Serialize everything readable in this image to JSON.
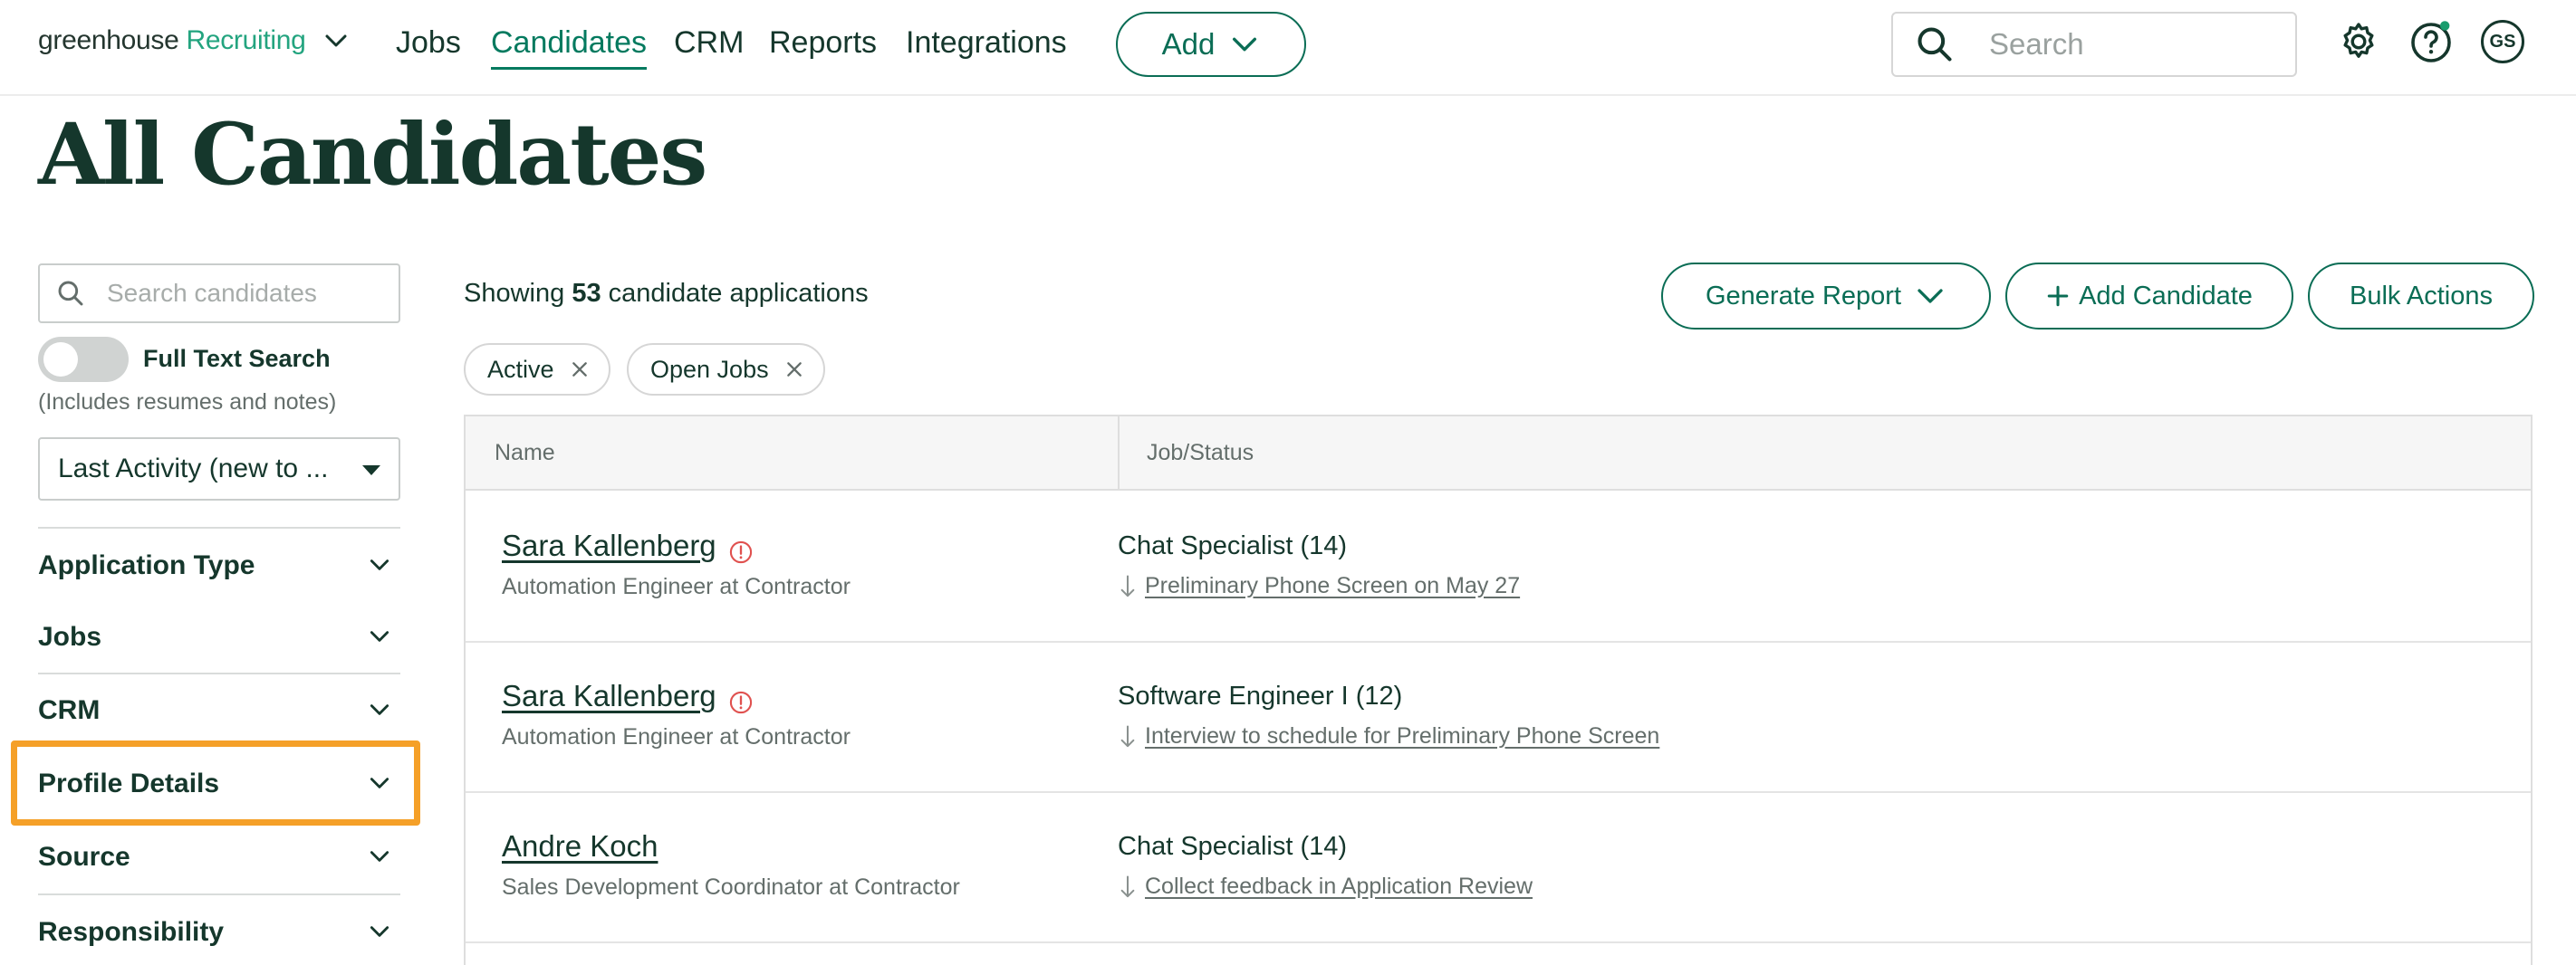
{
  "nav": {
    "logo_word1": "greenhouse",
    "logo_word2": "Recruiting",
    "links": [
      "Jobs",
      "Candidates",
      "CRM",
      "Reports",
      "Integrations"
    ],
    "active_link": "Candidates",
    "add_label": "Add",
    "search_placeholder": "Search",
    "avatar_initials": "GS"
  },
  "page": {
    "title": "All Candidates"
  },
  "sidebar": {
    "search_placeholder": "Search candidates",
    "full_text_label": "Full Text Search",
    "full_text_note": "(Includes resumes and notes)",
    "sort_value": "Last Activity (new to ...",
    "filters": [
      "Application Type",
      "Jobs",
      "CRM",
      "Profile Details",
      "Source",
      "Responsibility"
    ],
    "highlighted_filter": "Profile Details"
  },
  "main": {
    "showing_prefix": "Showing",
    "showing_count": "53",
    "showing_suffix": "candidate applications",
    "generate_report_label": "Generate Report",
    "add_candidate_label": "Add Candidate",
    "bulk_actions_label": "Bulk Actions",
    "chips": [
      "Active",
      "Open Jobs"
    ]
  },
  "table": {
    "columns": [
      "Name",
      "Job/Status"
    ],
    "rows": [
      {
        "name": "Sara Kallenberg",
        "alert": true,
        "subtitle": "Automation Engineer at Contractor",
        "job": "Chat Specialist (14)",
        "stage": "Preliminary Phone Screen on May 27"
      },
      {
        "name": "Sara Kallenberg",
        "alert": true,
        "subtitle": "Automation Engineer at Contractor",
        "job": "Software Engineer I (12)",
        "stage": "Interview to schedule for Preliminary Phone Screen"
      },
      {
        "name": "Andre Koch",
        "alert": false,
        "subtitle": "Sales Development Coordinator at Contractor",
        "job": "Chat Specialist (14)",
        "stage": "Collect feedback in Application Review"
      }
    ]
  },
  "colors": {
    "brand_green": "#047a5f",
    "text_dark": "#15372c",
    "highlight_orange": "#f5a028",
    "alert_red": "#e0514f"
  }
}
